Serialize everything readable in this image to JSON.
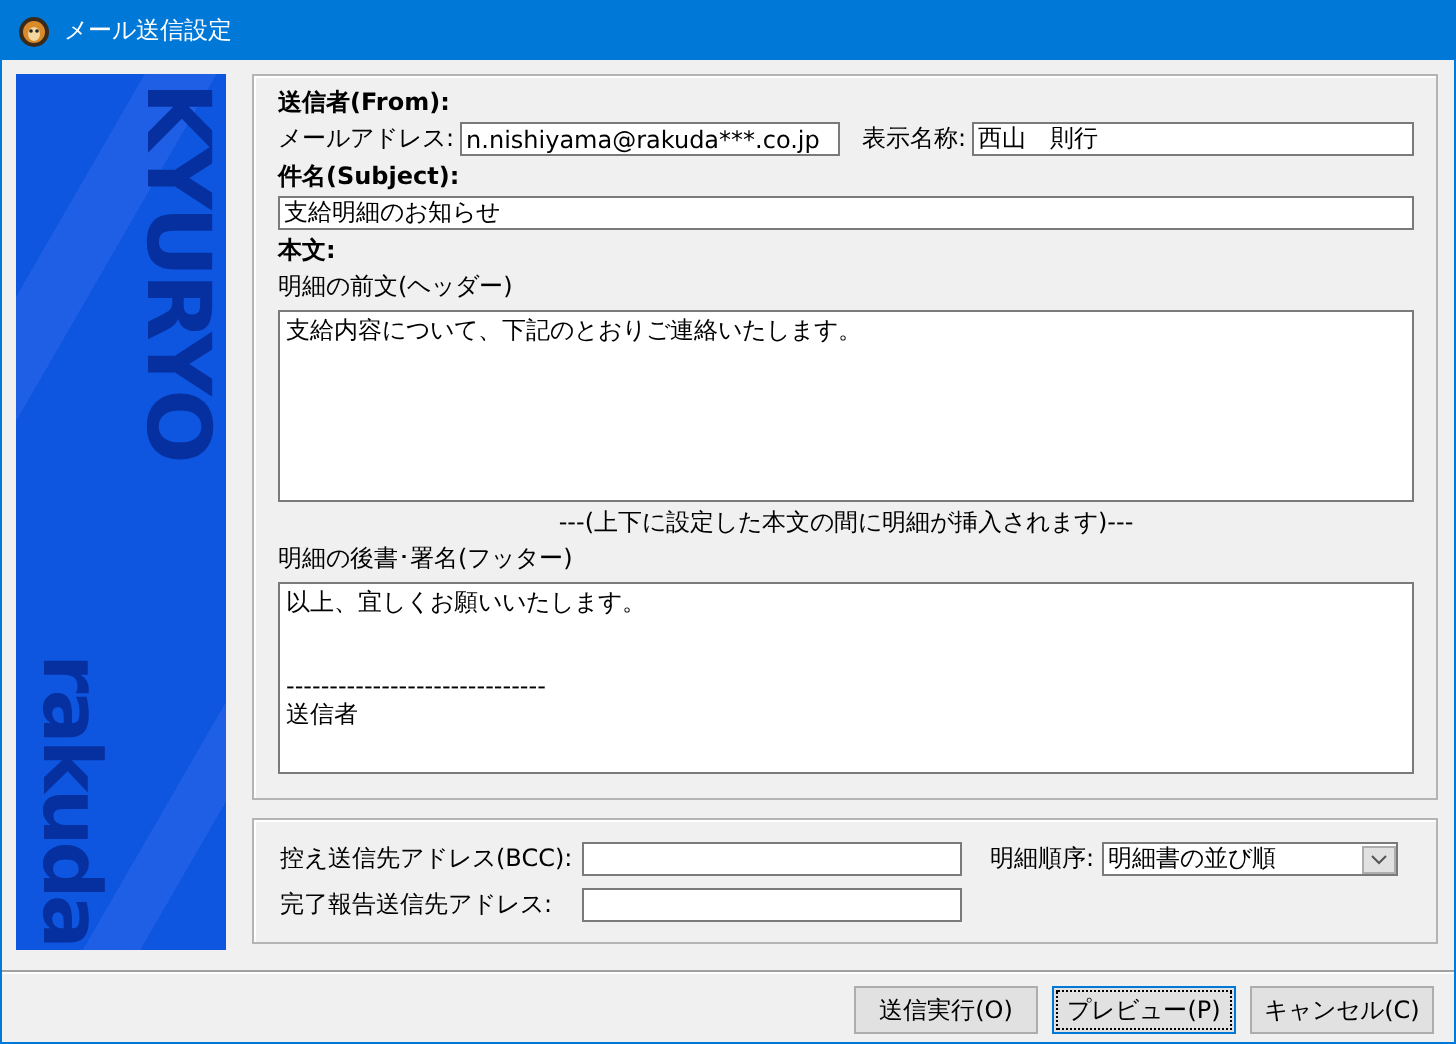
{
  "window": {
    "title": "メール送信設定"
  },
  "sidebar": {
    "brand_top": "KYURYO",
    "brand_bottom": "rakuda"
  },
  "sender": {
    "heading": "送信者(From):",
    "address_label": "メールアドレス:",
    "address_value": "n.nishiyama@rakuda***.co.jp",
    "display_label": "表示名称:",
    "display_value": "西山　則行"
  },
  "subject": {
    "heading": "件名(Subject):",
    "value": "支給明細のお知らせ"
  },
  "body": {
    "heading": "本文:",
    "header_label": "明細の前文(ヘッダー)",
    "header_value": "支給内容について、下記のとおりご連絡いたします。",
    "note": "---(上下に設定した本文の間に明細が挿入されます)---",
    "footer_label": "明細の後書･署名(フッター)",
    "footer_value": "以上、宜しくお願いいたします。\n\n\n------------------------------\n送信者"
  },
  "options": {
    "bcc_label": "控え送信先アドレス(BCC):",
    "report_label": "完了報告送信先アドレス:",
    "order_label": "明細順序:",
    "order_value": "明細書の並び順"
  },
  "buttons": [
    {
      "label": "送信実行(O)",
      "focused": false
    },
    {
      "label": "プレビュー(P)",
      "focused": true
    },
    {
      "label": "キャンセル(C)",
      "focused": false
    }
  ]
}
